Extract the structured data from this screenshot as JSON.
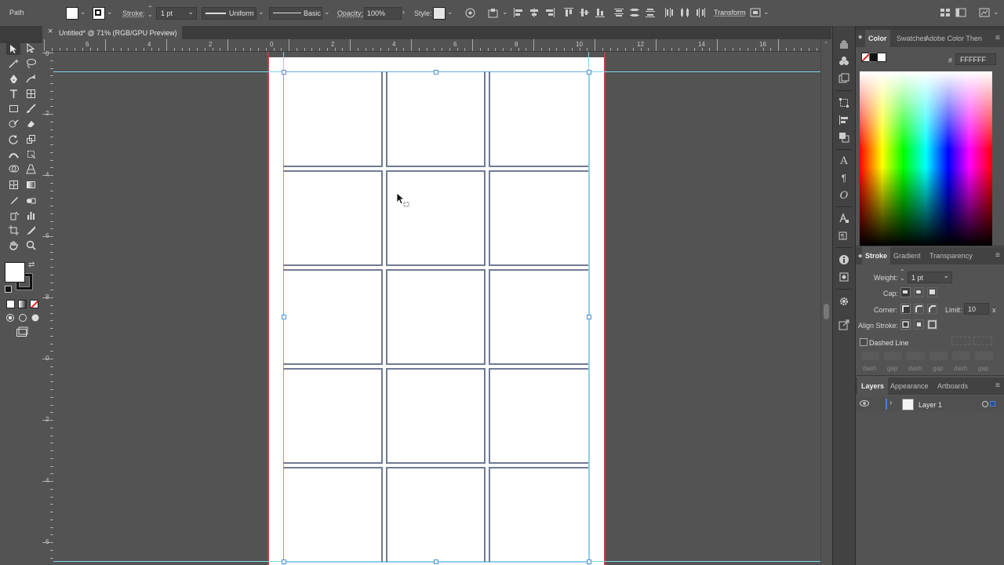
{
  "control_bar": {
    "selection_label": "Path",
    "stroke_label": "Stroke:",
    "stroke_value": "1 pt",
    "profile_label": "Uniform",
    "brush_label": "Basic",
    "opacity_label": "Opacity:",
    "opacity_value": "100%",
    "style_label": "Style:",
    "transform_label": "Transform"
  },
  "document_tab": {
    "title": "Untitled* @ 71% (RGB/GPU Preview)"
  },
  "rulers": {
    "horizontal": [
      "6",
      "4",
      "2",
      "0",
      "2",
      "4",
      "6",
      "8",
      "10",
      "12",
      "14",
      "16"
    ],
    "vertical": [
      "0",
      "2",
      "4",
      "6",
      "8",
      "0",
      "2",
      "4",
      "6"
    ]
  },
  "color_panel": {
    "tabs": [
      "Color",
      "Swatches",
      "Adobe Color Then"
    ],
    "hash": "#",
    "hex_value": "FFFFFF"
  },
  "stroke_panel": {
    "tabs": [
      "Stroke",
      "Gradient",
      "Transparency"
    ],
    "weight_label": "Weight:",
    "weight_value": "1 pt",
    "cap_label": "Cap:",
    "corner_label": "Corner:",
    "limit_label": "Limit:",
    "limit_value": "10",
    "limit_unit": "x",
    "align_label": "Align Stroke:",
    "dashed_label": "Dashed Line",
    "dash_labels": [
      "dash",
      "gap",
      "dash",
      "gap",
      "dash",
      "gap"
    ]
  },
  "layers_panel": {
    "tabs": [
      "Layers",
      "Appearance",
      "Artboards"
    ],
    "layer_name": "Layer 1"
  },
  "colors": {
    "ui_dark": "#535353",
    "panel_bg": "#323232",
    "canvas_bg": "#535353",
    "artboard": "#ffffff",
    "bleed": "#c0392b",
    "guide": "#7fd8e8",
    "selection": "#4a90d9"
  }
}
